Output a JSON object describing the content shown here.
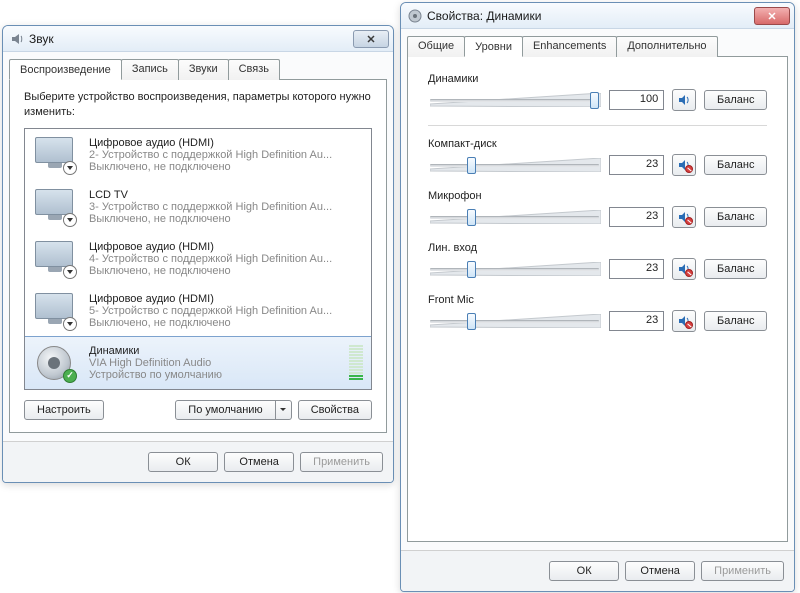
{
  "left": {
    "title": "Звук",
    "tabs": [
      "Воспроизведение",
      "Запись",
      "Звуки",
      "Связь"
    ],
    "active_tab": 0,
    "instruction": "Выберите устройство воспроизведения, параметры которого нужно изменить:",
    "devices": [
      {
        "title": "Цифровое аудио (HDMI)",
        "sub1": "2- Устройство с поддержкой High Definition Au...",
        "sub2": "Выключено, не подключено",
        "icon": "monitor",
        "badge": "arrow"
      },
      {
        "title": "LCD TV",
        "sub1": "3- Устройство с поддержкой High Definition Au...",
        "sub2": "Выключено, не подключено",
        "icon": "monitor",
        "badge": "arrow"
      },
      {
        "title": "Цифровое аудио (HDMI)",
        "sub1": "4- Устройство с поддержкой High Definition Au...",
        "sub2": "Выключено, не подключено",
        "icon": "monitor",
        "badge": "arrow"
      },
      {
        "title": "Цифровое аудио (HDMI)",
        "sub1": "5- Устройство с поддержкой High Definition Au...",
        "sub2": "Выключено, не подключено",
        "icon": "monitor",
        "badge": "arrow"
      },
      {
        "title": "Динамики",
        "sub1": "VIA High Definition Audio",
        "sub2": "Устройство по умолчанию",
        "icon": "speaker",
        "badge": "check",
        "selected": true
      }
    ],
    "btn_configure": "Настроить",
    "btn_default": "По умолчанию",
    "btn_props": "Свойства",
    "btn_ok": "ОК",
    "btn_cancel": "Отмена",
    "btn_apply": "Применить"
  },
  "right": {
    "title": "Свойства: Динамики",
    "tabs": [
      "Общие",
      "Уровни",
      "Enhancements",
      "Дополнительно"
    ],
    "active_tab": 1,
    "levels": [
      {
        "label": "Динамики",
        "value": "100",
        "pos": 100,
        "muted": false,
        "balance": "Баланс"
      },
      {
        "label": "Компакт-диск",
        "value": "23",
        "pos": 23,
        "muted": true,
        "balance": "Баланс"
      },
      {
        "label": "Микрофон",
        "value": "23",
        "pos": 23,
        "muted": true,
        "balance": "Баланс"
      },
      {
        "label": "Лин. вход",
        "value": "23",
        "pos": 23,
        "muted": true,
        "balance": "Баланс"
      },
      {
        "label": "Front Mic",
        "value": "23",
        "pos": 23,
        "muted": true,
        "balance": "Баланс"
      }
    ],
    "btn_ok": "ОК",
    "btn_cancel": "Отмена",
    "btn_apply": "Применить"
  }
}
